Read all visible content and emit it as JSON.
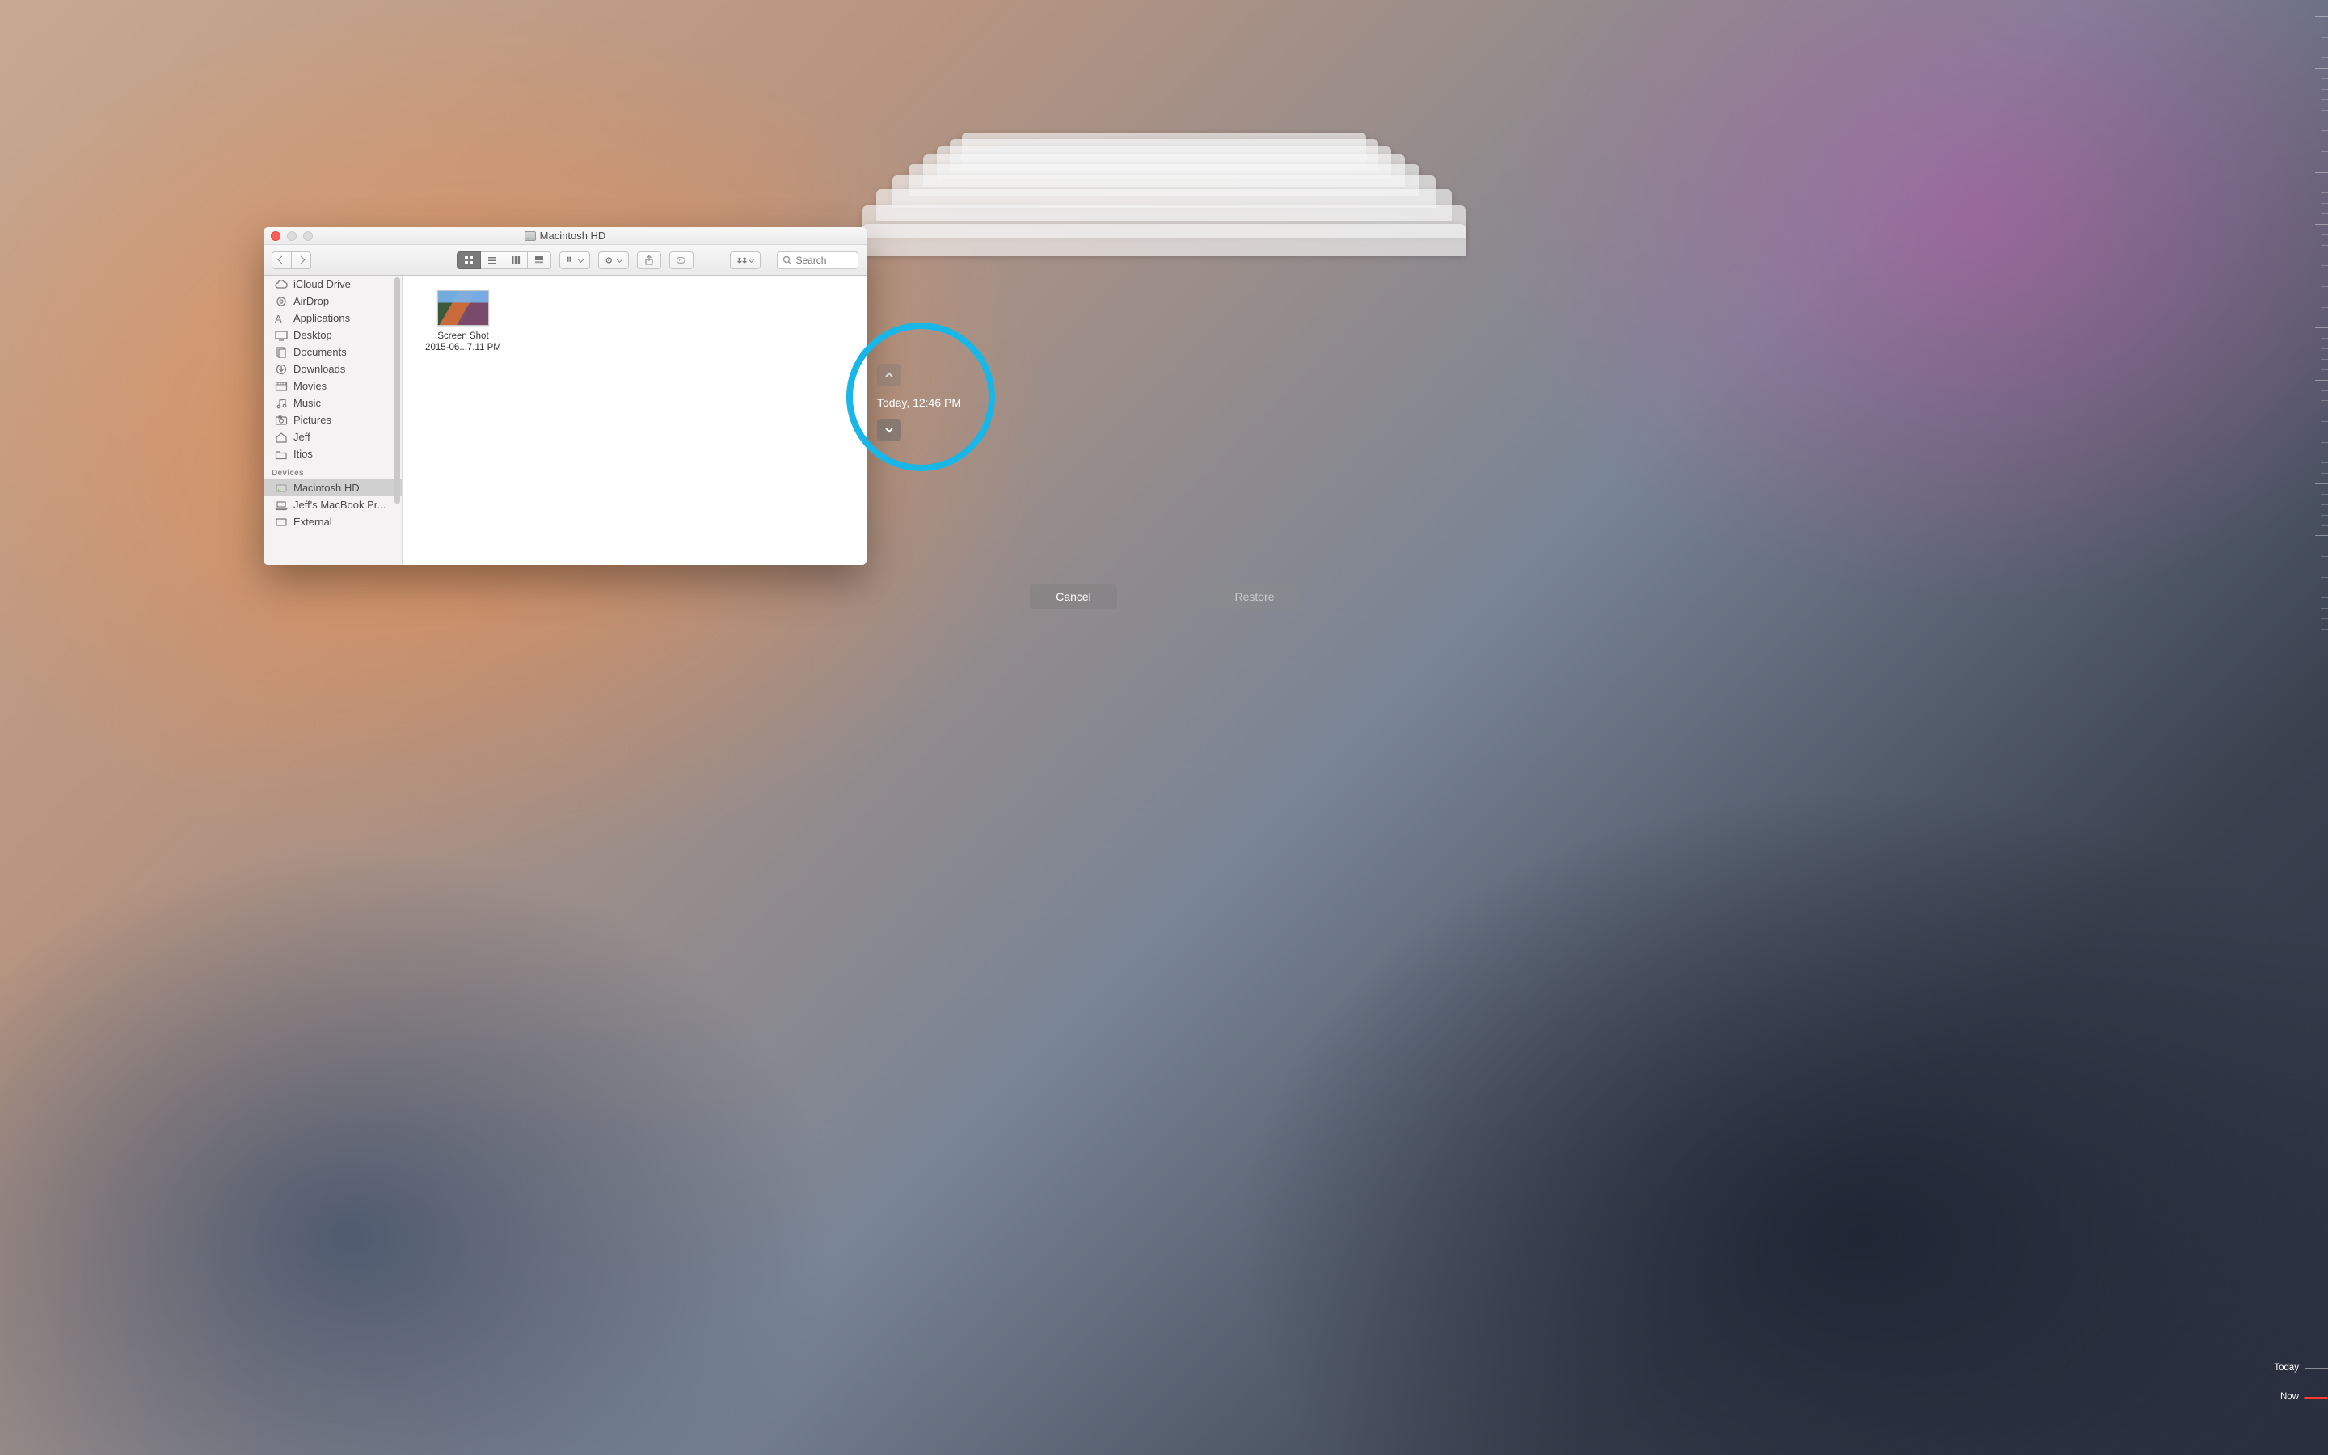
{
  "window": {
    "title": "Macintosh HD"
  },
  "toolbar": {
    "search_placeholder": "Search"
  },
  "sidebar": {
    "favorites": [
      {
        "key": "icloud",
        "label": "iCloud Drive",
        "icon": "cloud"
      },
      {
        "key": "airdrop",
        "label": "AirDrop",
        "icon": "airdrop"
      },
      {
        "key": "apps",
        "label": "Applications",
        "icon": "apps"
      },
      {
        "key": "desktop",
        "label": "Desktop",
        "icon": "desktop"
      },
      {
        "key": "documents",
        "label": "Documents",
        "icon": "documents"
      },
      {
        "key": "downloads",
        "label": "Downloads",
        "icon": "downloads"
      },
      {
        "key": "movies",
        "label": "Movies",
        "icon": "movies"
      },
      {
        "key": "music",
        "label": "Music",
        "icon": "music"
      },
      {
        "key": "pictures",
        "label": "Pictures",
        "icon": "pictures"
      },
      {
        "key": "jeff",
        "label": "Jeff",
        "icon": "home"
      },
      {
        "key": "itios",
        "label": "Itios",
        "icon": "folder"
      }
    ],
    "devices_label": "Devices",
    "devices": [
      {
        "key": "macintosh-hd",
        "label": "Macintosh HD",
        "icon": "hd",
        "selected": true
      },
      {
        "key": "macbook",
        "label": "Jeff's MacBook Pr...",
        "icon": "laptop"
      },
      {
        "key": "external",
        "label": "External",
        "icon": "hd-ext"
      }
    ]
  },
  "content": {
    "files": [
      {
        "name_line1": "Screen Shot",
        "name_line2": "2015-06...7.11 PM"
      }
    ]
  },
  "bottom": {
    "cancel": "Cancel",
    "restore": "Restore"
  },
  "timeline": {
    "current": "Today, 12:46 PM",
    "today_label": "Today",
    "now_label": "Now"
  }
}
